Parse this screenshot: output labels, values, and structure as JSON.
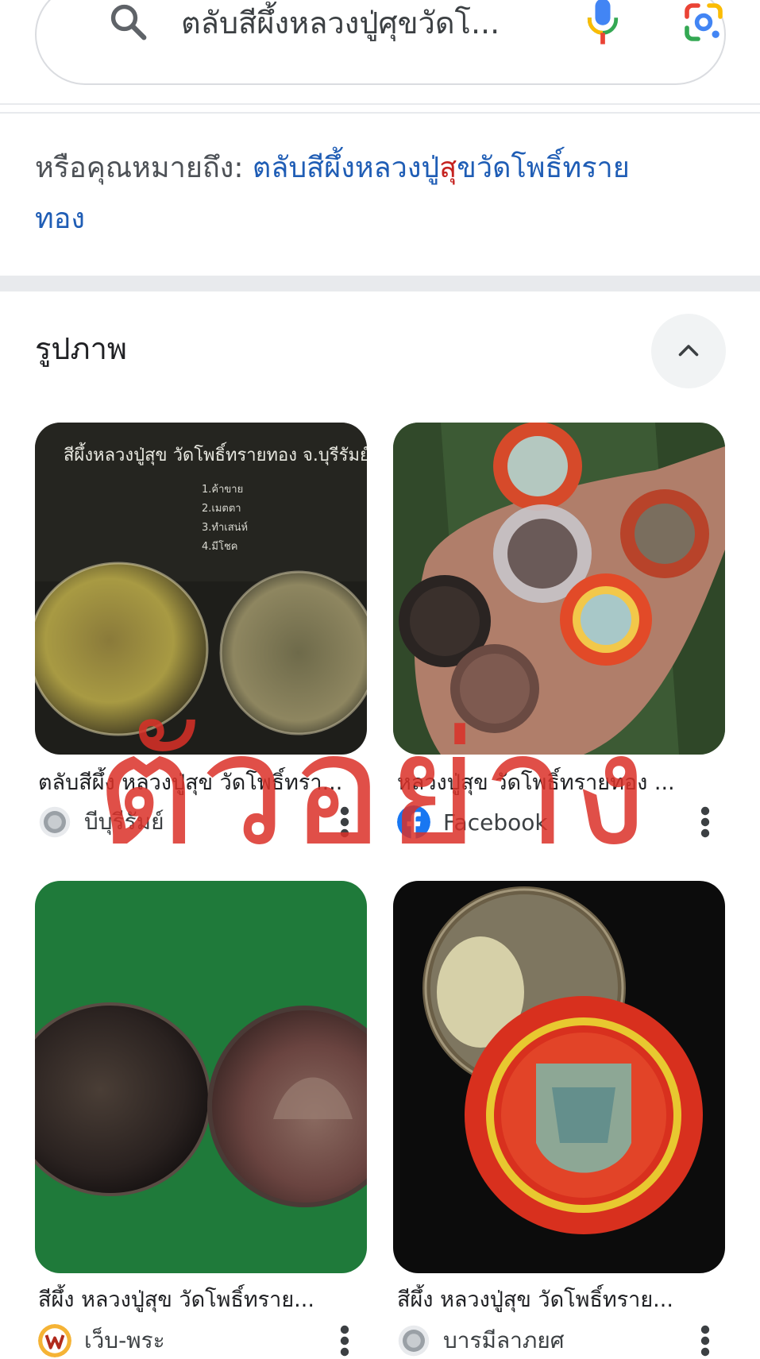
{
  "search": {
    "query": "ตลับสีผึ้งหลวงปู่ศุขวัดโ...",
    "search_icon": "search-icon",
    "mic_icon": "mic-icon",
    "lens_icon": "google-lens-icon"
  },
  "did_you_mean": {
    "prefix": "หรือคุณหมายถึง: ",
    "suggestion_part1": "ตลับสีผึ้งหลวงปู่",
    "suggestion_highlight": "สุ",
    "suggestion_part2": "ขวัดโพธิ์ทราย",
    "suggestion_line2": "ทอง"
  },
  "images_section": {
    "title": "รูปภาพ",
    "collapse_icon": "chevron-up-icon"
  },
  "results": [
    {
      "title": "ตลับสีผึ้ง หลวงปู่สุข วัดโพธิ์ทรา...",
      "source": "บีบุรีรัมย์",
      "source_icon": "globe-icon"
    },
    {
      "title": "หลวงปู่สุข วัดโพธิ์ทรายทอง ...",
      "source": "Facebook",
      "source_icon": "facebook-icon"
    },
    {
      "title": "สีผึ้ง หลวงปู่สุข วัดโพธิ์ทราย...",
      "source": "เว็บ-พระ",
      "source_icon": "web-pra-icon"
    },
    {
      "title": "สีผึ้ง หลวงปู่สุข วัดโพธิ์ทราย...",
      "source": "บารมีลาภยศ",
      "source_icon": "globe-icon"
    }
  ],
  "watermark": "ตัวอย่าง",
  "colors": {
    "link": "#1f5db5",
    "highlight": "#c5221f",
    "watermark": "#da3028"
  }
}
